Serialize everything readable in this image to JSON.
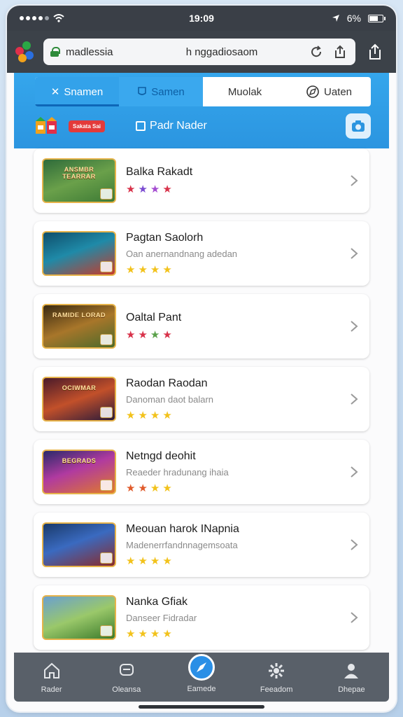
{
  "status": {
    "time": "19:09",
    "battery": "6%"
  },
  "browser": {
    "host": "madlessia",
    "path": "h nggadiosaom"
  },
  "tabs": [
    {
      "label": "Snamen",
      "icon": "tools-icon"
    },
    {
      "label": "Samen",
      "icon": "cup-icon"
    },
    {
      "label": "Muolak",
      "icon": ""
    },
    {
      "label": "Uaten",
      "icon": "compass-icon"
    }
  ],
  "subbar": {
    "promo": "Sakata Sai",
    "filter_label": "Padr Nader"
  },
  "games": [
    {
      "name": "Balka Rakadt",
      "subtitle": "",
      "thumb_text": "ANSMBR TEARRAR",
      "rating_colors": [
        "#d8324a",
        "#7a4bd1",
        "#a44bd1",
        "#d8324a"
      ]
    },
    {
      "name": "Pagtan Saolorh",
      "subtitle": "Oan anernandnang adedan",
      "thumb_text": "",
      "rating_colors": [
        "#f2c21b",
        "#f2c21b",
        "#f2c21b",
        "#f2c21b"
      ]
    },
    {
      "name": "Oaltal Pant",
      "subtitle": "",
      "thumb_text": "RAMIDE LORAD",
      "rating_colors": [
        "#d8324a",
        "#d8324a",
        "#5aa14a",
        "#d8324a"
      ]
    },
    {
      "name": "Raodan Raodan",
      "subtitle": "Danoman daot balarn",
      "thumb_text": "OCIWMAR",
      "rating_colors": [
        "#f2c21b",
        "#f2c21b",
        "#f2c21b",
        "#f2c21b"
      ]
    },
    {
      "name": "Netngd deohit",
      "subtitle": "Reaeder hradunang ihaia",
      "thumb_text": "BEGRADS",
      "rating_colors": [
        "#e05a2a",
        "#e05a2a",
        "#f2c21b",
        "#f2c21b"
      ]
    },
    {
      "name": "Meouan harok INapnia",
      "subtitle": "Madenerrfandnnagemsoata",
      "thumb_text": "",
      "rating_colors": [
        "#f2c21b",
        "#f2c21b",
        "#f2c21b",
        "#f2c21b"
      ]
    },
    {
      "name": "Nanka Gfiak",
      "subtitle": "Danseer Fidradar",
      "thumb_text": "",
      "rating_colors": [
        "#f2c21b",
        "#f2c21b",
        "#f2c21b",
        "#f2c21b"
      ]
    }
  ],
  "nav": [
    {
      "label": "Rader",
      "icon": "home-icon"
    },
    {
      "label": "Oleansa",
      "icon": "chat-icon"
    },
    {
      "label": "Eamede",
      "icon": "compass-icon"
    },
    {
      "label": "Feeadom",
      "icon": "gear-icon"
    },
    {
      "label": "Dhepae",
      "icon": "person-icon"
    }
  ]
}
